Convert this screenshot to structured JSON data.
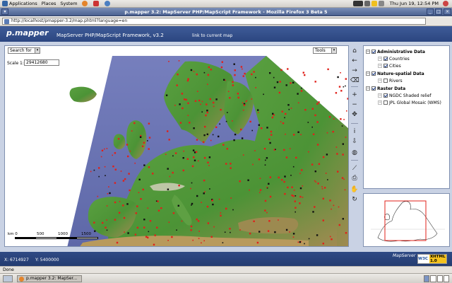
{
  "top_panel": {
    "menus": [
      "Applications",
      "Places",
      "System"
    ],
    "clock": "Thu Jun 19, 12:54 PM"
  },
  "window": {
    "title": "p.mapper 3.2: MapServer PHP/MapScript Framework - Mozilla Firefox 3 Beta 5"
  },
  "browser": {
    "url": "http://localhost/pmapper-3.2/map.phtml?language=en",
    "status": "Done",
    "taskbar_item": "p.mapper 3.2: MapSer..."
  },
  "header": {
    "logo": "p.mapper",
    "framework_title": "MapServer  PHP/MapScript  Framework, v3.2",
    "link_current_map": "link to current map"
  },
  "map_controls": {
    "search_label": "Search for",
    "tools_label": "Tools",
    "scale_label": "Scale 1:",
    "scale_value": "29412680"
  },
  "scalebar": {
    "unit": "km 0",
    "ticks": [
      "500",
      "1000",
      "1500"
    ]
  },
  "toolbar": {
    "tools": [
      {
        "icon": "home-icon",
        "glyph": "⌂"
      },
      {
        "icon": "back-icon",
        "glyph": "←"
      },
      {
        "icon": "forward-icon",
        "glyph": "→"
      },
      {
        "icon": "clear-selection-icon",
        "glyph": "⌫"
      },
      {
        "icon": "zoom-in-icon",
        "glyph": "+"
      },
      {
        "icon": "zoom-out-icon",
        "glyph": "−"
      },
      {
        "icon": "pan-icon",
        "glyph": "✥"
      },
      {
        "icon": "identify-icon",
        "glyph": "i"
      },
      {
        "icon": "select-icon",
        "glyph": "⇩"
      },
      {
        "icon": "auto-identify-icon",
        "glyph": "◍"
      },
      {
        "icon": "measure-icon",
        "glyph": "⟋"
      },
      {
        "icon": "print-icon",
        "glyph": "⎙"
      },
      {
        "icon": "download-icon",
        "glyph": "✋"
      },
      {
        "icon": "refresh-icon",
        "glyph": "↻"
      }
    ]
  },
  "toc": {
    "groups": [
      {
        "label": "Administrative Data",
        "checked": true,
        "layers": [
          {
            "label": "Countries",
            "checked": true
          },
          {
            "label": "Cities",
            "checked": true
          }
        ]
      },
      {
        "label": "Nature-spatial Data",
        "checked": true,
        "layers": [
          {
            "label": "Rivers",
            "checked": false
          }
        ]
      },
      {
        "label": "Raster Data",
        "checked": true,
        "layers": [
          {
            "label": "NGDC Shaded relief",
            "checked": true
          },
          {
            "label": "JPL Global Mosaic (WMS)",
            "checked": false
          }
        ]
      }
    ]
  },
  "footer": {
    "x_coord": "X:  6714927",
    "y_coord": "Y:  5400000",
    "mapserver_logo": "MapServer",
    "w3c_badge": "W3C",
    "xhtml_badge": "XHTML 1.0"
  },
  "colors": {
    "header_blue": "#2b4680",
    "body_blue": "#c9d2e4",
    "land_green": "#4f9a3a",
    "sea_blue": "#6f78b6",
    "city_red": "#e0201a"
  }
}
